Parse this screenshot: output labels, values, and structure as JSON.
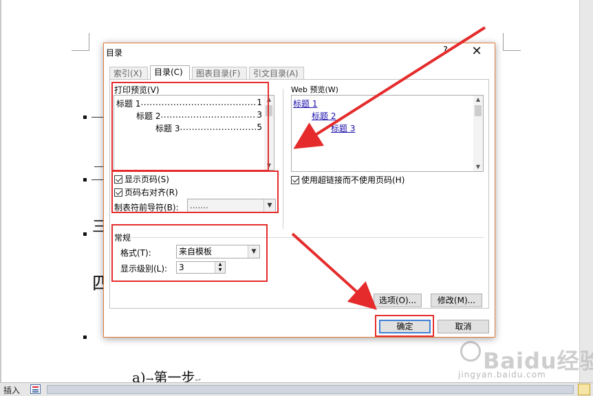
{
  "document": {
    "line_text": "a)",
    "line_text2": "第一步",
    "line_mark": "↩",
    "heading_glyph_3": "三",
    "heading_glyph_4": "四"
  },
  "dialog": {
    "title": "目录",
    "help": "?",
    "close": "✕",
    "tabs": [
      {
        "label": "索引(X)"
      },
      {
        "label": "目录(C)"
      },
      {
        "label": "图表目录(F)"
      },
      {
        "label": "引文目录(A)"
      }
    ],
    "print_preview": {
      "label": "打印预览(V)",
      "items": [
        {
          "text": "标题 1",
          "dots": "................................................",
          "page": "1"
        },
        {
          "text": "标题 2",
          "dots": "................................................",
          "page": "3"
        },
        {
          "text": "标题 3",
          "dots": "................................................",
          "page": "5"
        }
      ]
    },
    "web_preview": {
      "label": "Web 预览(W)",
      "items": [
        {
          "text": "标题 1"
        },
        {
          "text": "标题 2"
        },
        {
          "text": "标题 3"
        }
      ]
    },
    "show_page_numbers": {
      "label": "显示页码(S)",
      "checked": true
    },
    "right_align_page_numbers": {
      "label": "页码右对齐(R)",
      "checked": true
    },
    "tab_leader": {
      "label": "制表符前导符(B):",
      "value": "......."
    },
    "use_hyperlinks": {
      "label": "使用超链接而不使用页码(H)",
      "checked": true
    },
    "general": {
      "label": "常规",
      "formats": {
        "label": "格式(T):",
        "value": "来自模板"
      },
      "show_levels": {
        "label": "显示级别(L):",
        "value": "3"
      }
    },
    "options_button": "选项(O)...",
    "modify_button": "修改(M)...",
    "ok_button": "确定",
    "cancel_button": "取消"
  },
  "statusbar": {
    "mode": "插入"
  },
  "watermark": {
    "brand": "Baidu经验",
    "url": "jingyan.baidu.com"
  },
  "colors": {
    "highlight": "#e52b2b",
    "dialog_border": "#e07a3a",
    "link": "#1a0dab"
  }
}
